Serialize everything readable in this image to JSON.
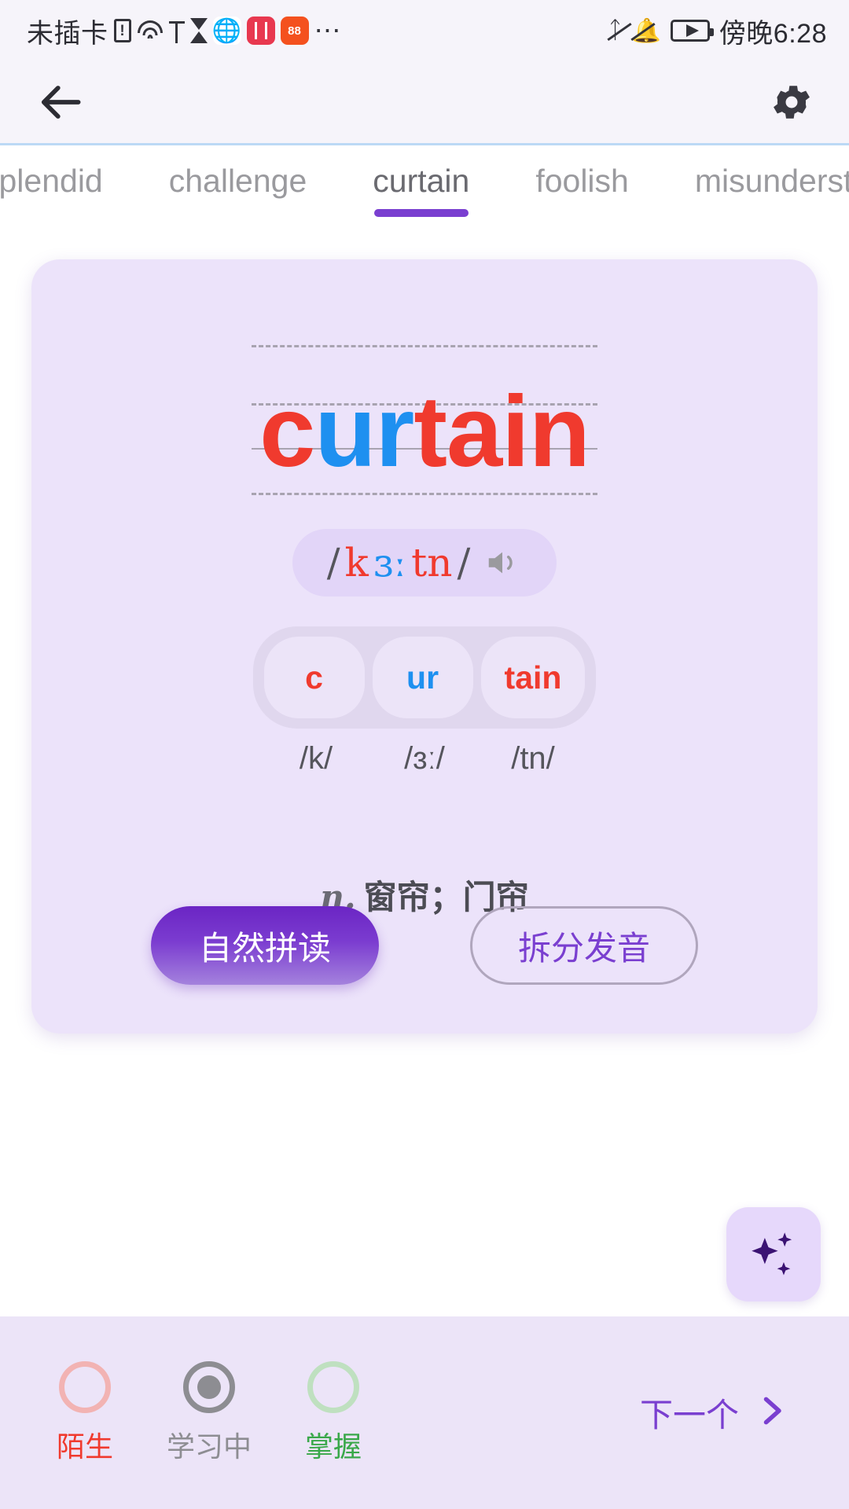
{
  "status_bar": {
    "carrier": "未插卡",
    "time": "傍晚6:28",
    "icons": [
      "sim-no-card-icon",
      "wifi-icon",
      "usb-icon",
      "hourglass-icon",
      "browser-app-icon",
      "redbook-app-icon",
      "orange-app-icon",
      "overflow-dots-icon",
      "bluetooth-icon",
      "notification-muted-icon",
      "battery-charging-icon"
    ]
  },
  "nav_bar": {
    "back_icon": "back-arrow-icon",
    "settings_icon": "gear-icon"
  },
  "tabs": [
    {
      "label": "splendid",
      "active": false
    },
    {
      "label": "challenge",
      "active": false
    },
    {
      "label": "curtain",
      "active": true
    },
    {
      "label": "foolish",
      "active": false
    },
    {
      "label": "misunderstand",
      "active": false
    }
  ],
  "card": {
    "word": "curtain",
    "word_parts": [
      {
        "text": "c",
        "color": "#f03a2e"
      },
      {
        "text": "ur",
        "color": "#1e90f0"
      },
      {
        "text": "tain",
        "color": "#f03a2e"
      }
    ],
    "phonetic": {
      "open_slash": "/",
      "close_slash": "/",
      "parts": [
        {
          "text": "k",
          "color": "#f03a2e"
        },
        {
          "text": "ɜː",
          "color": "#1e90f0"
        },
        {
          "text": "tn",
          "color": "#f03a2e"
        }
      ],
      "speaker_icon": "speaker-icon"
    },
    "syllables": [
      {
        "text": "c",
        "color": "#f03a2e",
        "phoneme": "/k/"
      },
      {
        "text": "ur",
        "color": "#1e90f0",
        "phoneme": "/ɜː/"
      },
      {
        "text": "tain",
        "color": "#f03a2e",
        "phoneme": "/tn/"
      }
    ],
    "definition": {
      "pos": "n.",
      "meaning": "窗帘；门帘"
    },
    "primary_button": "自然拼读",
    "secondary_button": "拆分发音"
  },
  "fab": {
    "icon": "sparkle-ai-icon"
  },
  "bottom_bar": {
    "marks": [
      {
        "label": "陌生",
        "state": "unselected",
        "color": "#f03a2e"
      },
      {
        "label": "学习中",
        "state": "selected",
        "color": "#8d8d92"
      },
      {
        "label": "掌握",
        "state": "unselected",
        "color": "#3aa84a"
      }
    ],
    "next_label": "下一个",
    "next_icon": "chevron-right-icon"
  },
  "theme": {
    "accent": "#7a3fd0",
    "card_bg": "#ece3fa",
    "red": "#f03a2e",
    "blue": "#1e90f0"
  }
}
